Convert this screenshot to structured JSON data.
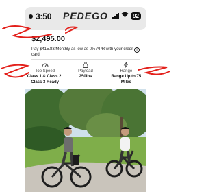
{
  "status_bar": {
    "time": "3:50",
    "brand": "PEDEGO",
    "battery": "92"
  },
  "product": {
    "price": "$2,495.00",
    "financing_text": "Pay $415.83/Monthly as low as 0% APR with your credit card"
  },
  "specs": [
    {
      "icon": "speedometer-icon",
      "label": "Top Speed",
      "value": "Class 1 & Class 2; Class 3 Ready"
    },
    {
      "icon": "weight-icon",
      "label": "Payload",
      "value": "250lbs"
    },
    {
      "icon": "lightning-icon",
      "label": "Range",
      "value": "Range Up to 75 Miles"
    }
  ],
  "colors": {
    "annotation_red": "#e3201b",
    "status_bar_bg": "#e9e9e9"
  }
}
